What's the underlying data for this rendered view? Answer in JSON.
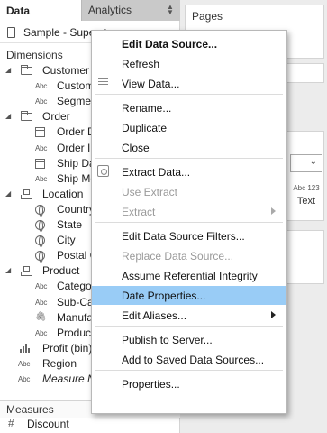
{
  "left_pane": {
    "tab_data": "Data",
    "tab_analytics": "Analytics",
    "data_source": "Sample - Superstore",
    "dimensions_header": "Dimensions",
    "measures_header": "Measures",
    "dimensions": [
      {
        "label": "Customer",
        "type": "folder",
        "expand": "open"
      },
      {
        "label": "Customer Name",
        "type": "abc"
      },
      {
        "label": "Segment",
        "type": "abc"
      },
      {
        "label": "Order",
        "type": "folder",
        "expand": "open"
      },
      {
        "label": "Order Date",
        "type": "date"
      },
      {
        "label": "Order ID",
        "type": "abc"
      },
      {
        "label": "Ship Date",
        "type": "date"
      },
      {
        "label": "Ship Mode",
        "type": "abc"
      },
      {
        "label": "Location",
        "type": "hierarchy",
        "expand": "open"
      },
      {
        "label": "Country",
        "type": "geo"
      },
      {
        "label": "State",
        "type": "geo"
      },
      {
        "label": "City",
        "type": "geo"
      },
      {
        "label": "Postal Code",
        "type": "geo"
      },
      {
        "label": "Product",
        "type": "hierarchy",
        "expand": "open"
      },
      {
        "label": "Category",
        "type": "abc"
      },
      {
        "label": "Sub-Category",
        "type": "abc"
      },
      {
        "label": "Manufacturer",
        "type": "group"
      },
      {
        "label": "Product Name",
        "type": "abc"
      },
      {
        "label": "Profit (bin)",
        "type": "bin"
      },
      {
        "label": "Region",
        "type": "abc"
      },
      {
        "label": "Measure Names",
        "type": "abc",
        "italic": true
      }
    ],
    "measures": [
      {
        "label": "Discount",
        "type": "number"
      }
    ]
  },
  "right_pane": {
    "pages_title": "Pages",
    "marks_text_icon": "Abc 123",
    "marks_text_label": "Text"
  },
  "context_menu": {
    "items": [
      {
        "label": "Edit Data Source...",
        "bold": true
      },
      {
        "label": "Refresh"
      },
      {
        "label": "View Data...",
        "icon": "grid-icon"
      },
      {
        "separator": true
      },
      {
        "label": "Rename..."
      },
      {
        "label": "Duplicate"
      },
      {
        "label": "Close"
      },
      {
        "separator": true
      },
      {
        "label": "Extract Data...",
        "icon": "extract-icon"
      },
      {
        "label": "Use Extract",
        "disabled": true
      },
      {
        "label": "Extract",
        "disabled": true,
        "submenu": true
      },
      {
        "separator": true
      },
      {
        "label": "Edit Data Source Filters..."
      },
      {
        "label": "Replace Data Source...",
        "disabled": true
      },
      {
        "label": "Assume Referential Integrity"
      },
      {
        "label": "Date Properties...",
        "highlighted": true
      },
      {
        "label": "Edit Aliases...",
        "submenu": true
      },
      {
        "separator": true
      },
      {
        "label": "Publish to Server..."
      },
      {
        "label": "Add to Saved Data Sources..."
      },
      {
        "separator": true
      },
      {
        "label": "Properties..."
      }
    ]
  },
  "colors": {
    "highlight": "#99ccf6",
    "disabled_text": "#9a9a9a",
    "analytics_tab": "#c9c9c9"
  }
}
